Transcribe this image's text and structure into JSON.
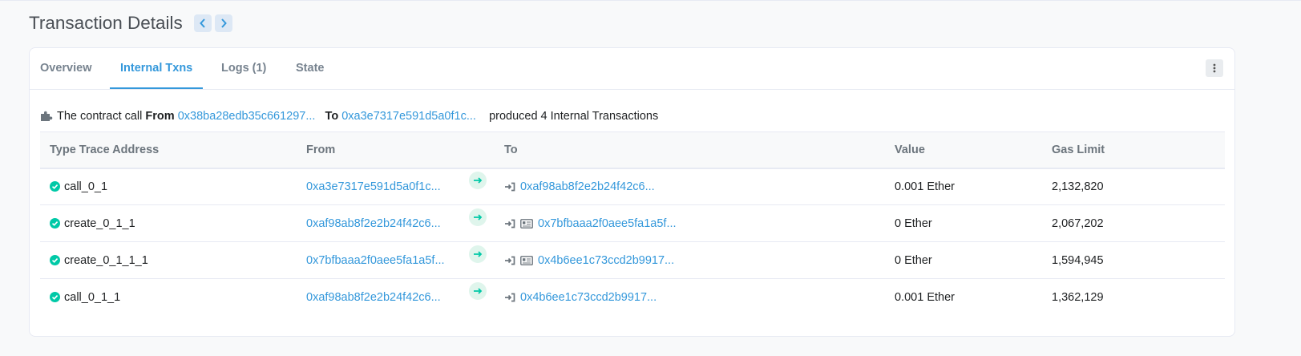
{
  "page": {
    "title": "Transaction Details"
  },
  "tabs": [
    {
      "label": "Overview"
    },
    {
      "label": "Internal Txns"
    },
    {
      "label": "Logs (1)"
    },
    {
      "label": "State"
    }
  ],
  "summary": {
    "prefix": "The contract call",
    "from_label": "From",
    "from_address": "0x38ba28edb35c661297...",
    "to_label": "To",
    "to_address": "0xa3e7317e591d5a0f1c...",
    "suffix": "produced 4 Internal Transactions"
  },
  "table": {
    "headers": [
      "Type Trace Address",
      "From",
      "To",
      "Value",
      "Gas Limit"
    ],
    "rows": [
      {
        "type": "call_0_1",
        "from": "0xa3e7317e591d5a0f1c...",
        "to": "0xaf98ab8f2e2b24f42c6...",
        "to_contract": false,
        "value": "0.001 Ether",
        "gas": "2,132,820"
      },
      {
        "type": "create_0_1_1",
        "from": "0xaf98ab8f2e2b24f42c6...",
        "to": "0x7bfbaaa2f0aee5fa1a5f...",
        "to_contract": true,
        "value": "0 Ether",
        "gas": "2,067,202"
      },
      {
        "type": "create_0_1_1_1",
        "from": "0x7bfbaaa2f0aee5fa1a5f...",
        "to": "0x4b6ee1c73ccd2b9917...",
        "to_contract": true,
        "value": "0 Ether",
        "gas": "1,594,945"
      },
      {
        "type": "call_0_1_1",
        "from": "0xaf98ab8f2e2b24f42c6...",
        "to": "0x4b6ee1c73ccd2b9917...",
        "to_contract": false,
        "value": "0.001 Ether",
        "gas": "1,362,129"
      }
    ]
  },
  "colors": {
    "link": "#3498db",
    "success": "#00c9a7",
    "muted": "#77838f"
  }
}
